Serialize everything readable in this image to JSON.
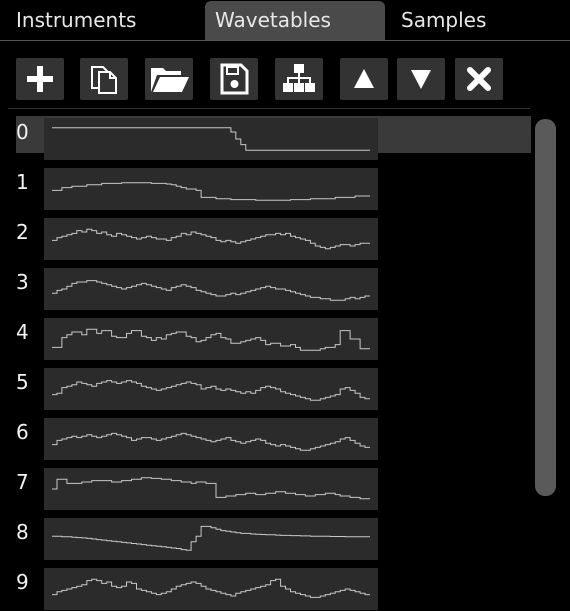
{
  "tabs": [
    {
      "id": "instruments",
      "label": "Instruments",
      "active": false
    },
    {
      "id": "wavetables",
      "label": "Wavetables",
      "active": true
    },
    {
      "id": "samples",
      "label": "Samples",
      "active": false
    }
  ],
  "toolbar": [
    {
      "name": "add-button",
      "icon": "plus-icon"
    },
    {
      "name": "duplicate-button",
      "icon": "copy-icon"
    },
    {
      "name": "open-button",
      "icon": "folder-open-icon"
    },
    {
      "name": "save-button",
      "icon": "floppy-disk-icon"
    },
    {
      "name": "hierarchy-button",
      "icon": "sitemap-icon"
    },
    {
      "name": "move-up-button",
      "icon": "triangle-up-icon"
    },
    {
      "name": "move-down-button",
      "icon": "triangle-down-icon"
    },
    {
      "name": "delete-button",
      "icon": "x-icon"
    }
  ],
  "selected_index": 0,
  "wavetables": [
    {
      "index": "0",
      "waveform": [
        0.9,
        0.9,
        0.9,
        0.9,
        0.9,
        0.9,
        0.9,
        0.9,
        0.9,
        0.9,
        0.9,
        0.9,
        0.9,
        0.9,
        0.9,
        0.9,
        0.9,
        0.9,
        0.9,
        0.9,
        0.9,
        0.9,
        0.9,
        0.9,
        0.9,
        0.9,
        0.9,
        0.9,
        0.9,
        0.9,
        0.9,
        0.9,
        0.9,
        0.9,
        0.9,
        0.9,
        0.75,
        0.5,
        0.3,
        0.1,
        0.1,
        0.1,
        0.1,
        0.1,
        0.1,
        0.1,
        0.1,
        0.1,
        0.1,
        0.1,
        0.1,
        0.1,
        0.1,
        0.1,
        0.1,
        0.1,
        0.1,
        0.1,
        0.1,
        0.1,
        0.1,
        0.1,
        0.1,
        0.1
      ]
    },
    {
      "index": "1",
      "waveform": [
        0.45,
        0.45,
        0.55,
        0.55,
        0.6,
        0.6,
        0.6,
        0.65,
        0.65,
        0.65,
        0.7,
        0.7,
        0.7,
        0.7,
        0.72,
        0.72,
        0.72,
        0.72,
        0.72,
        0.72,
        0.7,
        0.7,
        0.7,
        0.68,
        0.65,
        0.6,
        0.55,
        0.5,
        0.5,
        0.45,
        0.2,
        0.2,
        0.2,
        0.15,
        0.15,
        0.15,
        0.12,
        0.12,
        0.12,
        0.12,
        0.12,
        0.1,
        0.1,
        0.1,
        0.1,
        0.1,
        0.1,
        0.1,
        0.12,
        0.12,
        0.12,
        0.12,
        0.15,
        0.15,
        0.15,
        0.15,
        0.15,
        0.2,
        0.2,
        0.2,
        0.2,
        0.25,
        0.25,
        0.25
      ]
    },
    {
      "index": "2",
      "waveform": [
        0.45,
        0.55,
        0.6,
        0.65,
        0.7,
        0.8,
        0.75,
        0.85,
        0.8,
        0.7,
        0.75,
        0.65,
        0.6,
        0.7,
        0.65,
        0.6,
        0.55,
        0.5,
        0.55,
        0.6,
        0.55,
        0.5,
        0.5,
        0.45,
        0.55,
        0.6,
        0.7,
        0.65,
        0.75,
        0.7,
        0.65,
        0.6,
        0.55,
        0.45,
        0.4,
        0.45,
        0.4,
        0.35,
        0.4,
        0.45,
        0.5,
        0.55,
        0.6,
        0.65,
        0.65,
        0.7,
        0.65,
        0.7,
        0.6,
        0.55,
        0.5,
        0.45,
        0.35,
        0.25,
        0.2,
        0.15,
        0.2,
        0.25,
        0.3,
        0.3,
        0.25,
        0.3,
        0.35,
        0.35
      ]
    },
    {
      "index": "3",
      "waveform": [
        0.35,
        0.45,
        0.5,
        0.6,
        0.7,
        0.75,
        0.75,
        0.8,
        0.8,
        0.75,
        0.7,
        0.65,
        0.6,
        0.55,
        0.5,
        0.55,
        0.6,
        0.65,
        0.7,
        0.65,
        0.6,
        0.55,
        0.5,
        0.45,
        0.55,
        0.6,
        0.65,
        0.6,
        0.55,
        0.45,
        0.4,
        0.35,
        0.3,
        0.25,
        0.25,
        0.3,
        0.35,
        0.3,
        0.35,
        0.4,
        0.45,
        0.5,
        0.55,
        0.6,
        0.55,
        0.5,
        0.5,
        0.45,
        0.4,
        0.35,
        0.3,
        0.25,
        0.2,
        0.2,
        0.15,
        0.15,
        0.1,
        0.1,
        0.1,
        0.15,
        0.2,
        0.15,
        0.2,
        0.25
      ]
    },
    {
      "index": "4",
      "waveform": [
        0.2,
        0.2,
        0.55,
        0.65,
        0.75,
        0.75,
        0.65,
        0.85,
        0.85,
        0.7,
        0.8,
        0.8,
        0.6,
        0.55,
        0.55,
        0.7,
        0.8,
        0.8,
        0.6,
        0.55,
        0.45,
        0.55,
        0.5,
        0.65,
        0.7,
        0.75,
        0.75,
        0.6,
        0.55,
        0.4,
        0.45,
        0.55,
        0.65,
        0.7,
        0.55,
        0.5,
        0.35,
        0.35,
        0.4,
        0.45,
        0.5,
        0.55,
        0.45,
        0.3,
        0.35,
        0.35,
        0.25,
        0.25,
        0.3,
        0.2,
        0.1,
        0.1,
        0.1,
        0.1,
        0.15,
        0.2,
        0.2,
        0.3,
        0.8,
        0.8,
        0.5,
        0.5,
        0.15,
        0.15
      ]
    },
    {
      "index": "5",
      "waveform": [
        0.3,
        0.35,
        0.55,
        0.6,
        0.65,
        0.75,
        0.7,
        0.65,
        0.6,
        0.7,
        0.75,
        0.8,
        0.75,
        0.7,
        0.75,
        0.8,
        0.75,
        0.7,
        0.6,
        0.55,
        0.5,
        0.45,
        0.5,
        0.55,
        0.6,
        0.65,
        0.7,
        0.75,
        0.7,
        0.65,
        0.5,
        0.55,
        0.6,
        0.5,
        0.45,
        0.5,
        0.45,
        0.4,
        0.35,
        0.4,
        0.35,
        0.45,
        0.55,
        0.6,
        0.55,
        0.5,
        0.4,
        0.35,
        0.3,
        0.25,
        0.2,
        0.15,
        0.1,
        0.1,
        0.15,
        0.2,
        0.25,
        0.3,
        0.5,
        0.55,
        0.45,
        0.35,
        0.2,
        0.15
      ]
    },
    {
      "index": "6",
      "waveform": [
        0.3,
        0.45,
        0.5,
        0.55,
        0.6,
        0.55,
        0.6,
        0.65,
        0.6,
        0.55,
        0.6,
        0.65,
        0.7,
        0.65,
        0.6,
        0.55,
        0.45,
        0.5,
        0.55,
        0.55,
        0.5,
        0.45,
        0.5,
        0.55,
        0.6,
        0.65,
        0.7,
        0.65,
        0.6,
        0.55,
        0.5,
        0.45,
        0.4,
        0.45,
        0.5,
        0.55,
        0.45,
        0.4,
        0.35,
        0.4,
        0.45,
        0.5,
        0.45,
        0.35,
        0.3,
        0.25,
        0.3,
        0.25,
        0.2,
        0.15,
        0.1,
        0.1,
        0.15,
        0.2,
        0.25,
        0.3,
        0.35,
        0.4,
        0.5,
        0.55,
        0.45,
        0.35,
        0.25,
        0.2
      ]
    },
    {
      "index": "7",
      "waveform": [
        0.5,
        0.85,
        0.85,
        0.7,
        0.7,
        0.7,
        0.75,
        0.75,
        0.8,
        0.8,
        0.8,
        0.8,
        0.75,
        0.75,
        0.8,
        0.8,
        0.85,
        0.85,
        0.9,
        0.9,
        0.88,
        0.88,
        0.85,
        0.85,
        0.8,
        0.8,
        0.75,
        0.75,
        0.7,
        0.75,
        0.75,
        0.7,
        0.7,
        0.2,
        0.2,
        0.25,
        0.25,
        0.3,
        0.3,
        0.35,
        0.35,
        0.3,
        0.3,
        0.35,
        0.35,
        0.4,
        0.4,
        0.35,
        0.35,
        0.3,
        0.3,
        0.25,
        0.25,
        0.3,
        0.3,
        0.35,
        0.35,
        0.3,
        0.25,
        0.25,
        0.2,
        0.2,
        0.15,
        0.15
      ]
    },
    {
      "index": "8",
      "waveform": [
        0.6,
        0.6,
        0.58,
        0.58,
        0.56,
        0.55,
        0.54,
        0.52,
        0.5,
        0.48,
        0.46,
        0.44,
        0.42,
        0.4,
        0.38,
        0.36,
        0.34,
        0.32,
        0.3,
        0.28,
        0.26,
        0.24,
        0.22,
        0.2,
        0.18,
        0.16,
        0.12,
        0.1,
        0.4,
        0.6,
        0.95,
        0.95,
        0.9,
        0.85,
        0.8,
        0.78,
        0.75,
        0.72,
        0.7,
        0.7,
        0.68,
        0.67,
        0.66,
        0.65,
        0.65,
        0.64,
        0.63,
        0.63,
        0.62,
        0.62,
        0.61,
        0.61,
        0.6,
        0.6,
        0.6,
        0.6,
        0.59,
        0.59,
        0.59,
        0.58,
        0.58,
        0.58,
        0.58,
        0.58
      ]
    },
    {
      "index": "9",
      "waveform": [
        0.3,
        0.4,
        0.45,
        0.5,
        0.55,
        0.6,
        0.65,
        0.8,
        0.85,
        0.8,
        0.7,
        0.75,
        0.6,
        0.55,
        0.6,
        0.75,
        0.7,
        0.5,
        0.45,
        0.4,
        0.35,
        0.3,
        0.35,
        0.4,
        0.5,
        0.6,
        0.65,
        0.7,
        0.75,
        0.7,
        0.6,
        0.5,
        0.45,
        0.4,
        0.35,
        0.3,
        0.25,
        0.35,
        0.4,
        0.45,
        0.5,
        0.55,
        0.6,
        0.65,
        0.8,
        0.85,
        0.6,
        0.5,
        0.4,
        0.35,
        0.3,
        0.25,
        0.2,
        0.2,
        0.25,
        0.3,
        0.35,
        0.4,
        0.45,
        0.5,
        0.45,
        0.4,
        0.35,
        0.3
      ]
    }
  ]
}
